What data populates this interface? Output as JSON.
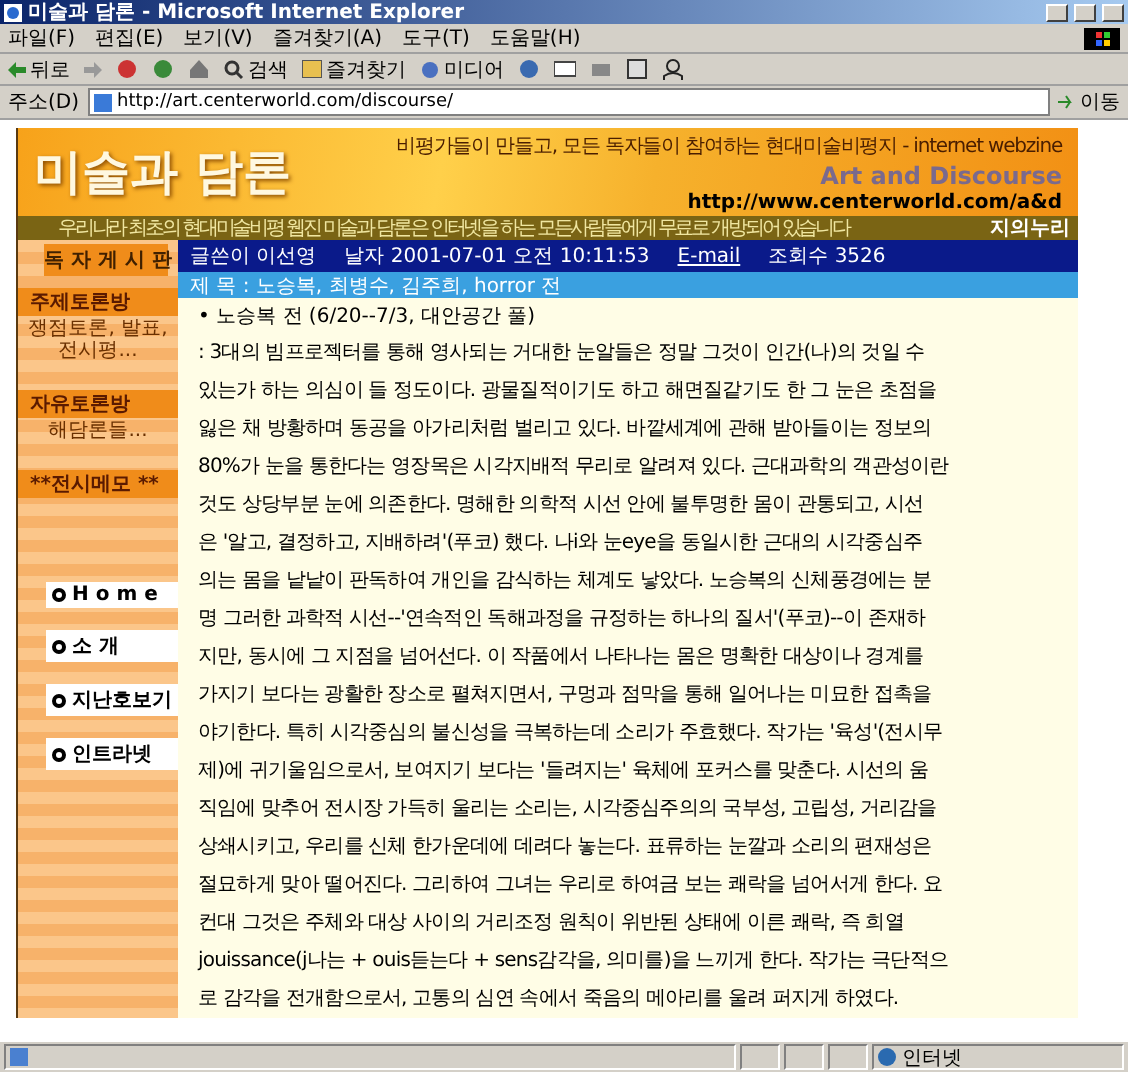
{
  "window": {
    "title": "미술과 담론 - Microsoft Internet Explorer"
  },
  "menu": [
    "파일(F)",
    "편집(E)",
    "보기(V)",
    "즐겨찾기(A)",
    "도구(T)",
    "도움말(H)"
  ],
  "toolbar": {
    "back": "뒤로",
    "search": "검색",
    "favorites": "즐겨찾기",
    "media": "미디어"
  },
  "address": {
    "label": "주소(D)",
    "url": "http://art.centerworld.com/discourse/",
    "go": "이동"
  },
  "banner": {
    "logo": "미술과 담론",
    "tagline": "비평가들이 만들고, 모든 독자들이 참여하는 현대미술비평지 - internet webzine",
    "title_en": "Art and Discourse",
    "url": "http://www.centerworld.com/a&d",
    "notice": "우리나라 최초의 현대미술비평 웹진 미술과 담론은 인터넷을 하는 모든사람들에게 무료로 개방되어 있습니다",
    "link": "지의누리"
  },
  "sidebar": {
    "heading": "독 자 게 시 판",
    "sections": [
      {
        "title": "주제토론방",
        "text": "쟁점토론, 발표, 전시평..."
      },
      {
        "title": "자유토론방",
        "text": "해담론들..."
      },
      {
        "title": "**전시메모 **"
      }
    ],
    "nav": [
      "H o m e",
      "소 개",
      "지난호보기",
      "인트라넷"
    ]
  },
  "post": {
    "author_label": "글쓴이",
    "author": "이선영",
    "date_label": "날자",
    "date": "2001-07-01 오전 10:11:53",
    "email": "E-mail",
    "views_label": "조회수",
    "views": "3526",
    "subject": "제 목 : 노승복, 최병수, 김주희, horror 전",
    "heading": "• 노승복 전 (6/20--7/3, 대안공간 풀)",
    "lines": [
      ": 3대의 빔프로젝터를 통해 영사되는 거대한 눈알들은 정말 그것이 인간(나)의 것일 수",
      "있는가 하는 의심이 들 정도이다. 광물질적이기도 하고 해면질같기도 한 그 눈은 초점을",
      "잃은 채 방황하며 동공을 아가리처럼 벌리고 있다. 바깥세계에 관해 받아들이는 정보의",
      "80%가 눈을 통한다는 영장목은 시각지배적 무리로 알려져 있다. 근대과학의 객관성이란",
      "것도 상당부분 눈에 의존한다. 명해한 의학적 시선 안에 불투명한 몸이 관통되고, 시선",
      "은 '알고, 결정하고, 지배하려'(푸코) 했다. 나i와 눈eye을 동일시한 근대의 시각중심주",
      "의는 몸을 낱낱이 판독하여 개인을 감식하는 체계도 낳았다. 노승복의 신체풍경에는 분",
      "명 그러한 과학적 시선--'연속적인 독해과정을 규정하는 하나의 질서'(푸코)--이 존재하",
      "지만, 동시에 그 지점을 넘어선다. 이 작품에서 나타나는 몸은 명확한 대상이나 경계를",
      "가지기 보다는 광활한 장소로 펼쳐지면서, 구멍과 점막을 통해 일어나는 미묘한 접촉을",
      "야기한다. 특히 시각중심의 불신성을 극복하는데 소리가 주효했다. 작가는 '육성'(전시무",
      "제)에 귀기울임으로서, 보여지기 보다는 '들려지는' 육체에 포커스를 맞춘다. 시선의 움",
      "직임에 맞추어 전시장 가득히 울리는 소리는, 시각중심주의의 국부성, 고립성, 거리감을",
      "상쇄시키고, 우리를 신체 한가운데에 데려다 놓는다. 표류하는 눈깔과 소리의 편재성은",
      "절묘하게 맞아 떨어진다. 그리하여 그녀는 우리로 하여금 보는 쾌락을 넘어서게 한다. 요",
      "컨대 그것은 주체와 대상 사이의 거리조정 원칙이 위반된 상태에 이른 쾌락, 즉 희열",
      "jouissance(j나는 + ouis듣는다 + sens감각을, 의미를)을 느끼게 한다. 작가는 극단적으",
      "로 감각을 전개함으로서, 고통의 심연 속에서 죽음의 메아리를 울려 퍼지게 하였다."
    ]
  },
  "status": {
    "zone": "인터넷"
  }
}
